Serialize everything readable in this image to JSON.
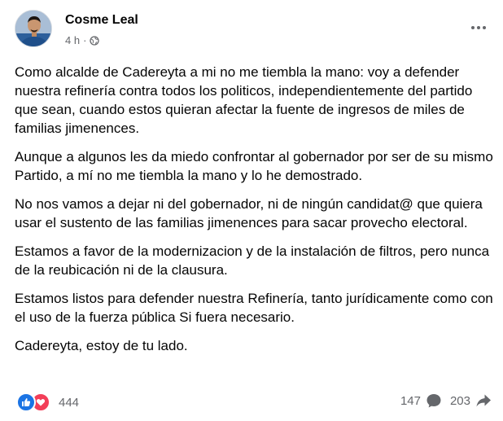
{
  "post": {
    "author": "Cosme Leal",
    "time": "4 h",
    "privacy_icon": "globe-icon",
    "paragraphs": [
      "Como alcalde de Cadereyta a mi no me tiembla la mano: voy a defender nuestra refinería contra todos los politicos, independientemente del partido que sean, cuando estos quieran afectar la fuente de ingresos de miles de familias jimenences.",
      "Aunque a algunos les da miedo confrontar al gobernador por ser de su mismo Partido, a mí no me tiembla la mano y lo he demostrado.",
      "No nos vamos a dejar ni del gobernador, ni de ningún candidat@  que quiera usar el sustento de las familias jimenences para sacar provecho electoral.",
      "Estamos a favor de la modernizacion y de la instalación de filtros, pero nunca de la reubicación ni de la clausura.",
      "Estamos listos para defender nuestra Refinería, tanto jurídicamente como con el uso de la fuerza pública Si fuera necesario.",
      "Cadereyta, estoy de tu lado."
    ]
  },
  "stats": {
    "reactions_count": "444",
    "comments_count": "147",
    "shares_count": "203"
  },
  "colors": {
    "like": "#1b74e4",
    "love": "#f33e58",
    "muted": "#65676b"
  }
}
